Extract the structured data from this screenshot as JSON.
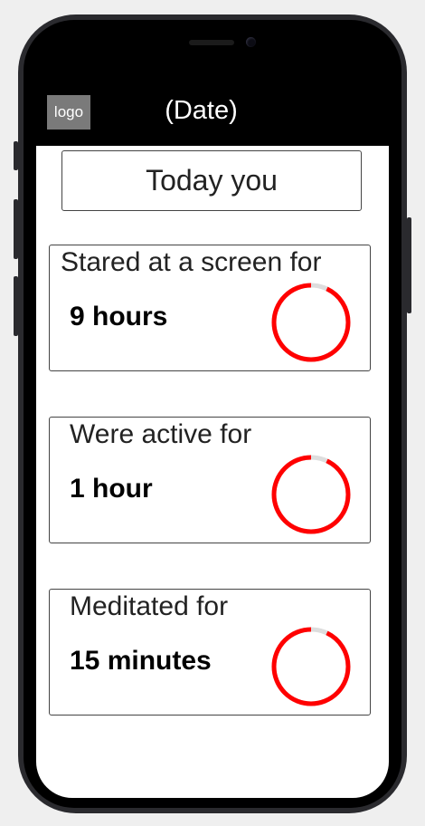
{
  "header": {
    "logo_text": "logo",
    "title": "(Date)"
  },
  "today_label": "Today you",
  "stats": [
    {
      "label": "Stared at a screen for",
      "value": "9 hours",
      "ring_fraction": 0.93,
      "ring_icon": "progress-ring-icon"
    },
    {
      "label": "Were active for",
      "value": "1 hour",
      "ring_fraction": 0.93,
      "ring_icon": "progress-ring-icon"
    },
    {
      "label": "Meditated for",
      "value": "15 minutes",
      "ring_fraction": 0.93,
      "ring_icon": "progress-ring-icon"
    }
  ],
  "colors": {
    "ring_fill": "#ff0000",
    "ring_track": "#dddddd",
    "header_bg": "#000000",
    "logo_bg": "#7a7a7a"
  }
}
